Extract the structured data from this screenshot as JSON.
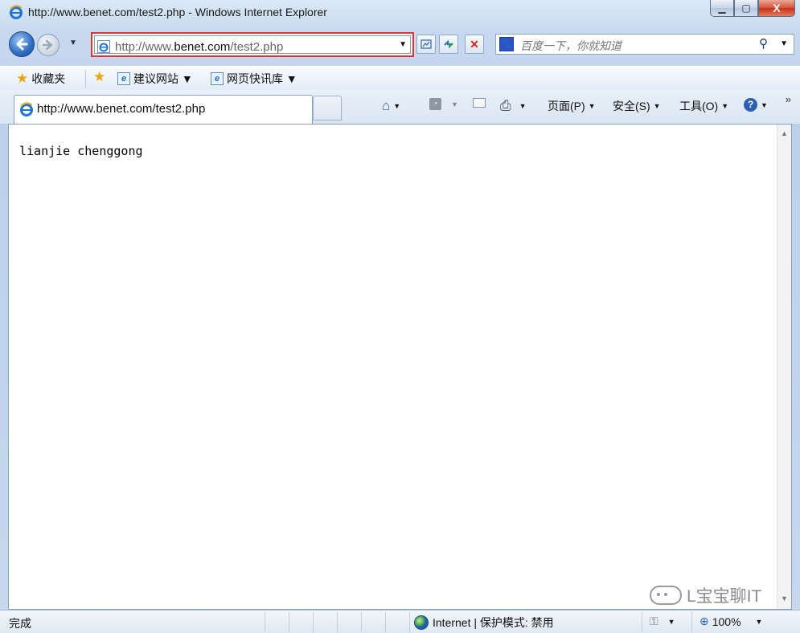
{
  "window": {
    "title": "http://www.benet.com/test2.php - Windows Internet Explorer",
    "minimize_label": "▁",
    "maximize_label": "▢",
    "close_label": "X"
  },
  "address_bar": {
    "url_prefix": "http://www.",
    "url_domain": "benet.com",
    "url_path": "/test2.php",
    "highlight_color": "#e03333"
  },
  "search": {
    "provider_icon": "baidu-paw-icon",
    "placeholder": "百度一下，你就知道"
  },
  "favorites_bar": {
    "favorites_label": "收藏夹",
    "items": [
      {
        "label": "建议网站 ▼",
        "icon": "ie-page-icon"
      },
      {
        "label": "网页快讯库 ▼",
        "icon": "ie-page-icon"
      }
    ]
  },
  "tab": {
    "label": "http://www.benet.com/test2.php"
  },
  "command_bar": {
    "page_label": "页面(P)",
    "safety_label": "安全(S)",
    "tools_label": "工具(O)",
    "overflow": "»"
  },
  "content": {
    "body_text": "lianjie chenggong"
  },
  "watermark": {
    "text": "L宝宝聊IT"
  },
  "status_bar": {
    "status_text": "完成",
    "zone_text": "Internet | 保护模式: 禁用",
    "zoom": "100%"
  }
}
